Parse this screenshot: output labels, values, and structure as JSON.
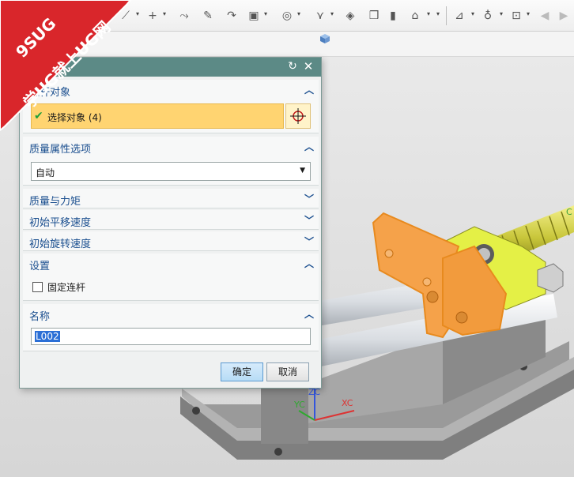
{
  "watermark": {
    "brand": "9SUG",
    "slogan": "学UG就上UG网"
  },
  "toolbar": {
    "icons": [
      "line-icon",
      "point-icon",
      "route-icon",
      "hand-icon",
      "arrow-icon",
      "view-icon",
      "rotate-icon",
      "tangent-icon",
      "shape-icon",
      "box-icon",
      "pipe-icon",
      "measure-icon",
      "analysis-icon",
      "probe-icon",
      "fit-icon",
      "nav-back-icon",
      "nav-forward-icon"
    ]
  },
  "dialog": {
    "title": "",
    "sections": {
      "link_objects": {
        "label": "连杆对象",
        "selection_label": "选择对象 (4)"
      },
      "mass_options": {
        "label": "质量属性选项",
        "selected": "自动"
      },
      "mass_moment": {
        "label": "质量与力矩"
      },
      "init_translate": {
        "label": "初始平移速度"
      },
      "init_rotate": {
        "label": "初始旋转速度"
      },
      "settings": {
        "label": "设置",
        "fix_link_label": "固定连杆",
        "fix_link_checked": false
      },
      "name": {
        "label": "名称",
        "value": "L002"
      }
    },
    "ok_label": "确定",
    "cancel_label": "取消"
  },
  "viewport": {
    "axis_zc": "ZC",
    "axis_xc": "XC",
    "axis_yc": "YC",
    "colors": {
      "highlight": "#f5a24a",
      "selected_yellow": "#e4f046",
      "base": "#8e8e8e"
    }
  }
}
